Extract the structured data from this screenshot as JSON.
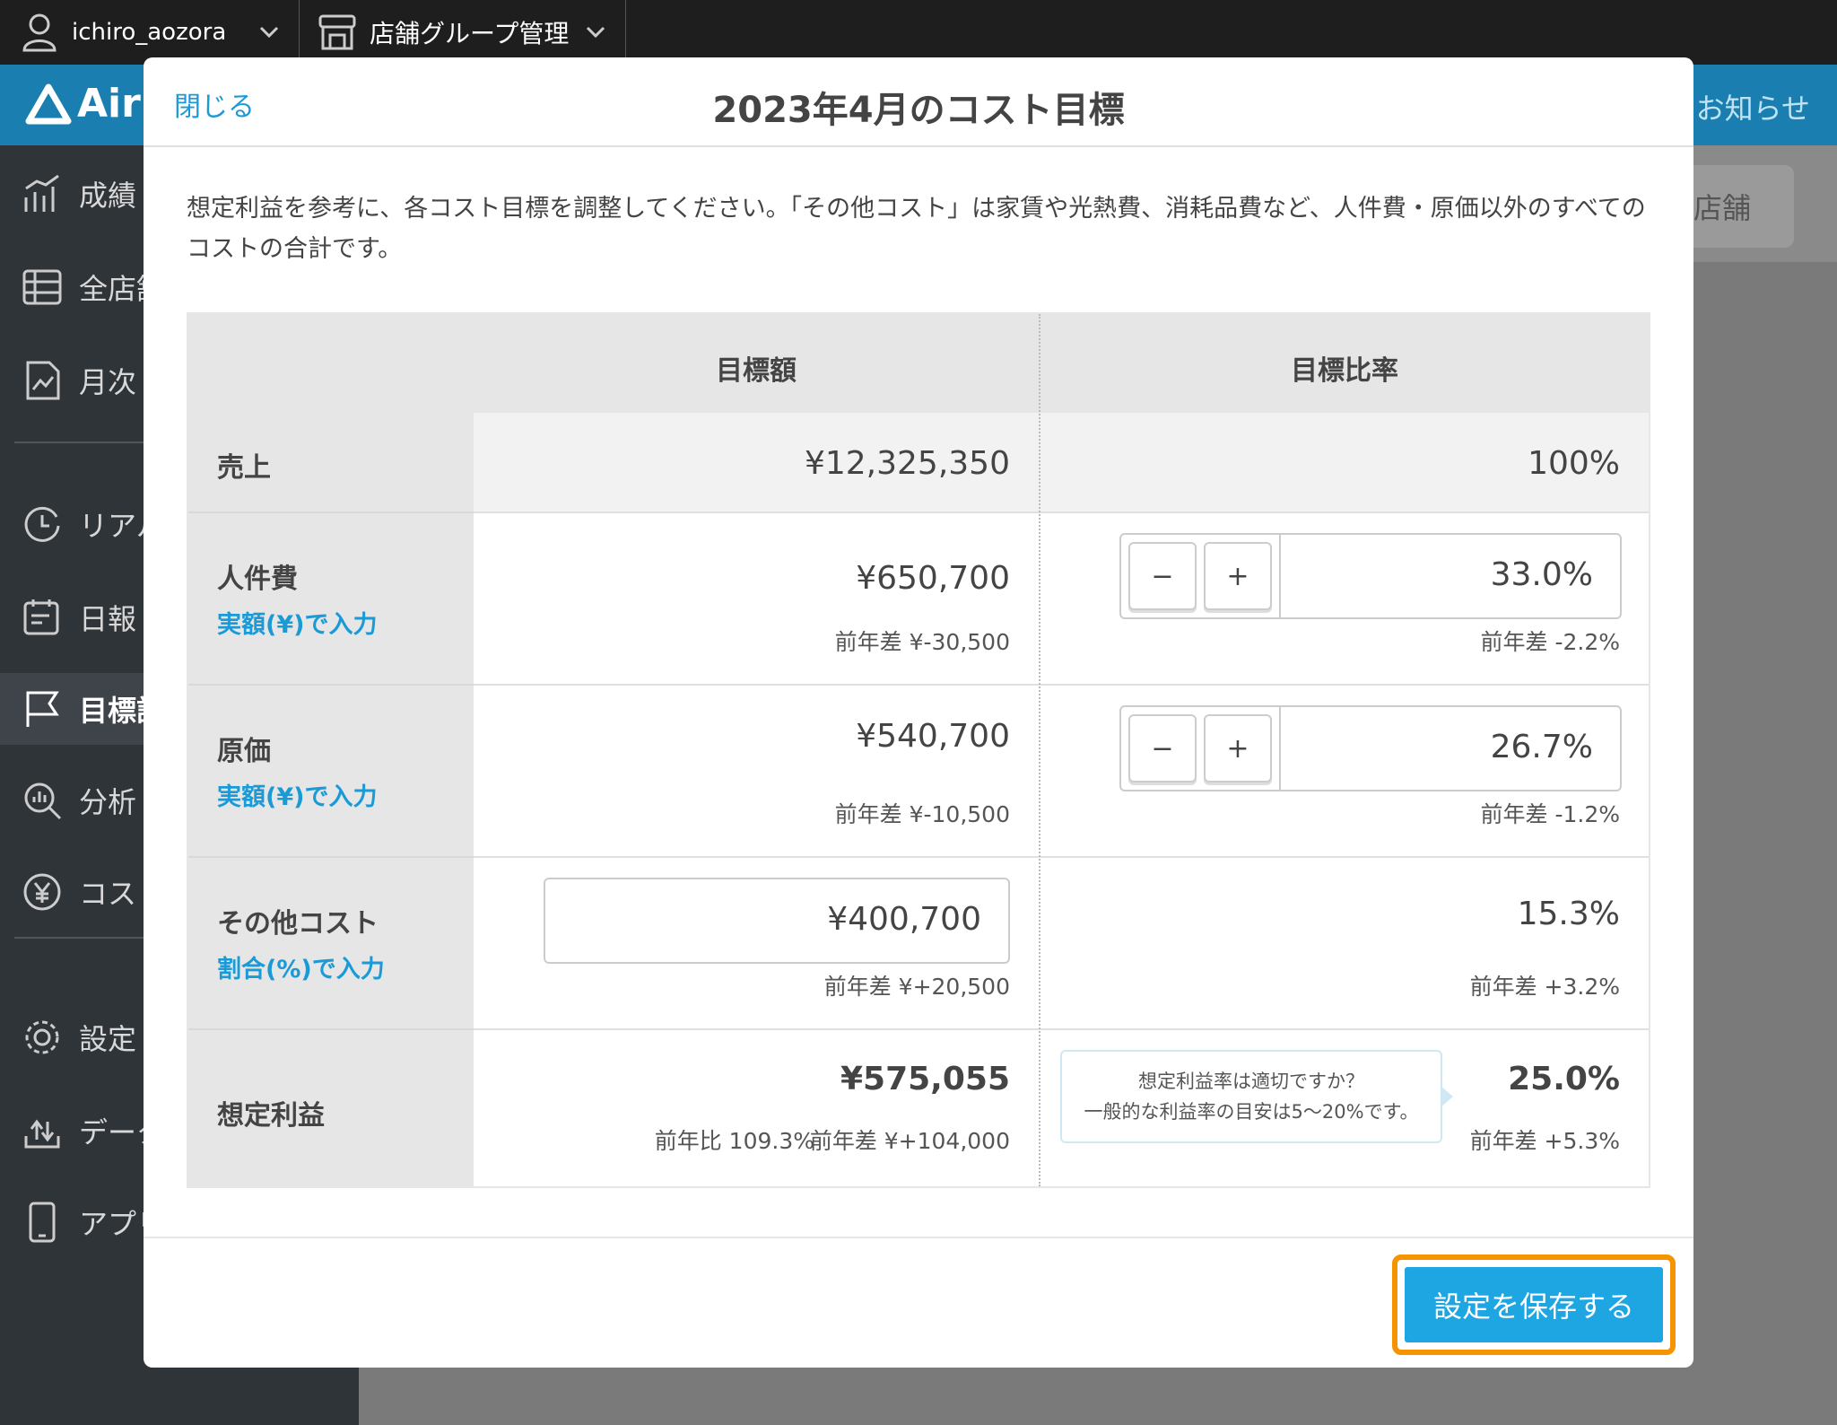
{
  "topbar": {
    "account_name": "ichiro_aozora",
    "group_label": "店舗グループ管理"
  },
  "header": {
    "logo_text": "Air",
    "notice_label": "お知らせ",
    "store_button": "店舗"
  },
  "sidebar": {
    "items": [
      {
        "label": "成績",
        "icon": "chart-bar-icon"
      },
      {
        "label": "全店舗",
        "icon": "table-icon"
      },
      {
        "label": "月次",
        "icon": "monthly-report-icon"
      },
      {
        "label": "リアルタイム",
        "icon": "clock-icon"
      },
      {
        "label": "日報",
        "icon": "calendar-edit-icon"
      },
      {
        "label": "目標設定",
        "icon": "flag-icon"
      },
      {
        "label": "分析",
        "icon": "analysis-icon"
      },
      {
        "label": "コスト",
        "icon": "yen-icon"
      },
      {
        "label": "設定",
        "icon": "gear-icon"
      },
      {
        "label": "データ",
        "icon": "upload-icon"
      },
      {
        "label": "アプリ",
        "icon": "phone-icon"
      }
    ]
  },
  "modal": {
    "close_label": "閉じる",
    "title": "2023年4月のコスト目標",
    "description": "想定利益を参考に、各コスト目標を調整してください。「その他コスト」は家賃や光熱費、消耗品費など、人件費・原価以外のすべてのコストの合計です。",
    "table": {
      "col_amount": "目標額",
      "col_ratio": "目標比率",
      "sales": {
        "label": "売上",
        "amount": "¥12,325,350",
        "ratio": "100%"
      },
      "labor": {
        "label": "人件費",
        "link": "実額(¥)で入力",
        "amount": "¥650,700",
        "amount_diff": "前年差 ¥-30,500",
        "ratio": "33.0%",
        "ratio_diff": "前年差 -2.2%"
      },
      "cogs": {
        "label": "原価",
        "link": "実額(¥)で入力",
        "amount": "¥540,700",
        "amount_diff": "前年差 ¥-10,500",
        "ratio": "26.7%",
        "ratio_diff": "前年差 -1.2%"
      },
      "other": {
        "label": "その他コスト",
        "link": "割合(%)で入力",
        "amount": "¥400,700",
        "amount_diff": "前年差 ¥+20,500",
        "ratio": "15.3%",
        "ratio_diff": "前年差 +3.2%"
      },
      "profit": {
        "label": "想定利益",
        "amount": "¥575,055",
        "yoy_ratio": "前年比 109.3%",
        "amount_diff": "前年差 ¥+104,000",
        "ratio": "25.0%",
        "ratio_diff": "前年差 +5.3%"
      },
      "tooltip_line1": "想定利益率は適切ですか？",
      "tooltip_line2": "一般的な利益率の目安は5〜20%です。",
      "minus": "−",
      "plus": "+"
    },
    "save_label": "設定を保存する"
  }
}
